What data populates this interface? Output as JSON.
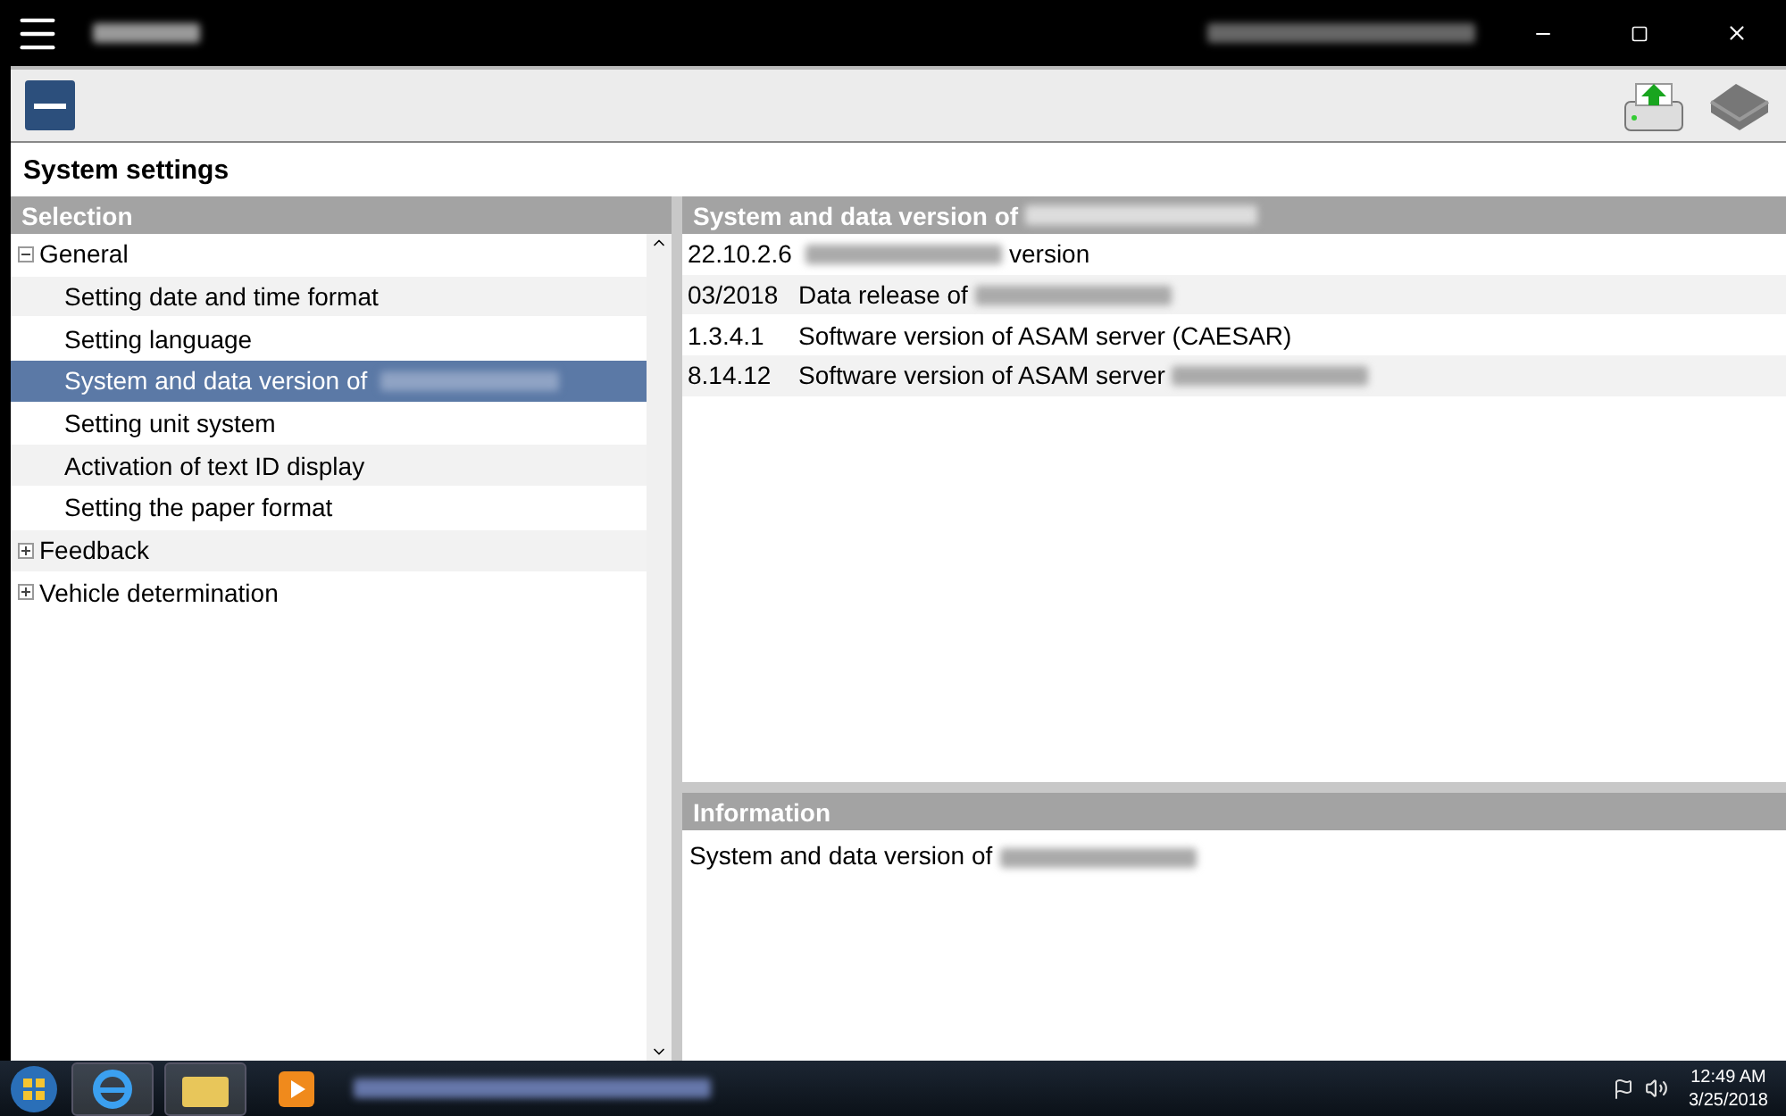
{
  "page_title": "System settings",
  "selection": {
    "header": "Selection",
    "tree": [
      {
        "label": "General",
        "expanded": true,
        "selected": false,
        "children": [
          {
            "label": "Setting date and time format",
            "selected": false
          },
          {
            "label": "Setting language",
            "selected": false
          },
          {
            "label": "System and data version of",
            "redacted": true,
            "selected": true
          },
          {
            "label": "Setting unit system",
            "selected": false
          },
          {
            "label": "Activation of text ID display",
            "selected": false
          },
          {
            "label": "Setting the paper format",
            "selected": false
          }
        ]
      },
      {
        "label": "Feedback",
        "expanded": false,
        "selected": false
      },
      {
        "label": "Vehicle determination",
        "expanded": false,
        "selected": false
      }
    ]
  },
  "versions": {
    "header": "System and data version of",
    "header_redacted": true,
    "rows": [
      {
        "value": "22.10.2.6",
        "redacted": true,
        "text_after": "version"
      },
      {
        "value": "03/2018",
        "text": "Data release of",
        "redacted": true
      },
      {
        "value": "1.3.4.1",
        "text": "Software version of ASAM server (CAESAR)",
        "redacted": false
      },
      {
        "value": "8.14.12",
        "text": "Software version of ASAM server",
        "redacted": true
      }
    ]
  },
  "information": {
    "header": "Information",
    "text": "System and data version of",
    "redacted": true
  },
  "taskbar": {
    "time": "12:49 AM",
    "date": "3/25/2018"
  }
}
